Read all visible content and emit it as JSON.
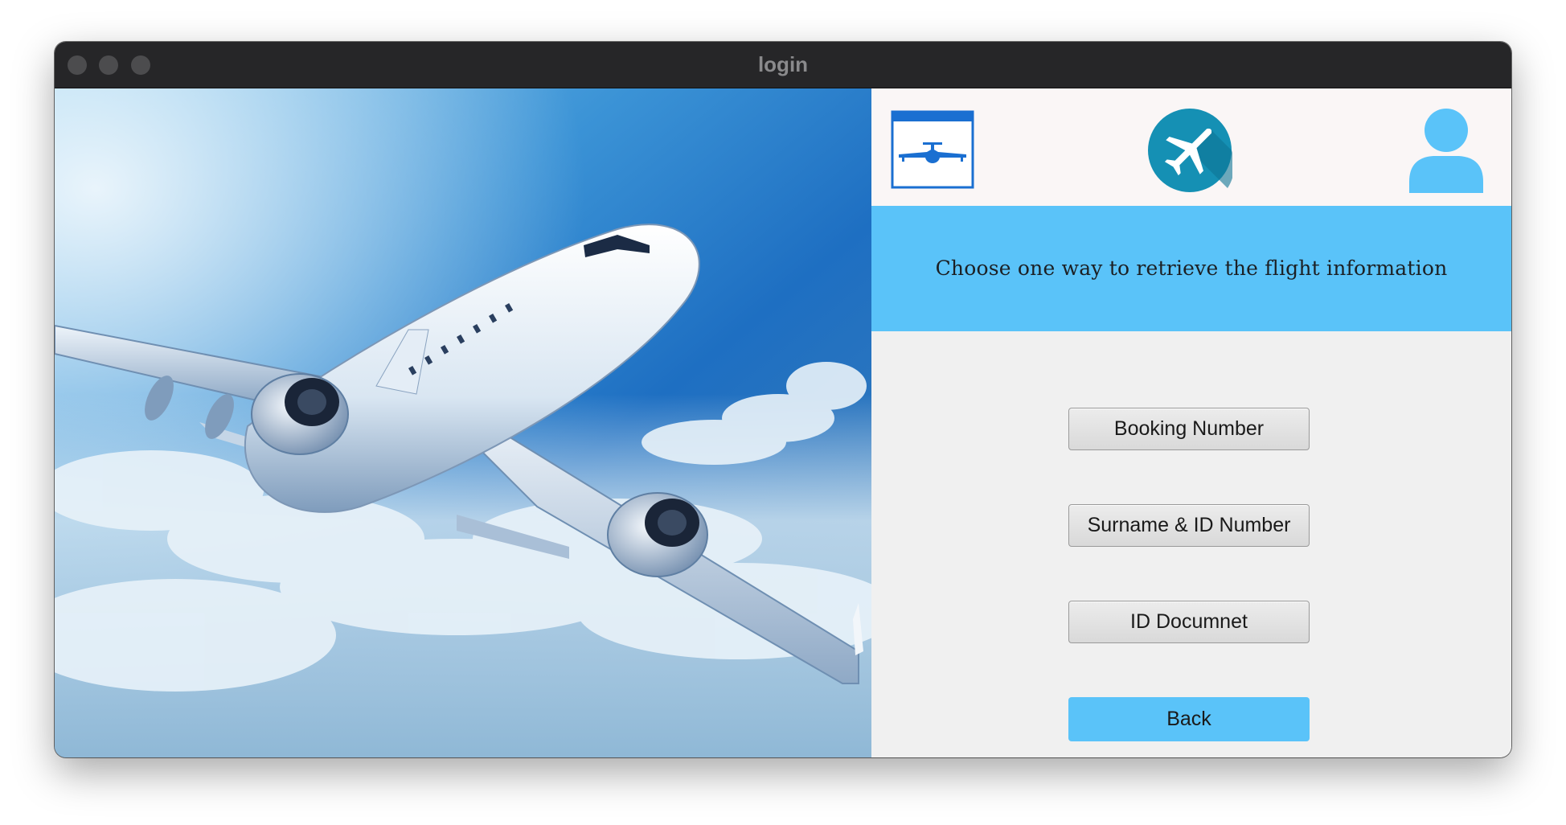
{
  "window": {
    "title": "login"
  },
  "header_icons": {
    "left": "flight-board-icon",
    "center": "airplane-circle-icon",
    "right": "user-icon"
  },
  "banner": {
    "text": "Choose one way to retrieve the flight information"
  },
  "buttons": {
    "booking_number": "Booking Number",
    "surname_id": "Surname & ID Number",
    "id_document": "ID Documnet",
    "back": "Back"
  },
  "colors": {
    "accent": "#5ac3f9",
    "icon_blue": "#1a6fd1",
    "circle_teal": "#1590b4",
    "titlebar": "#262628"
  }
}
